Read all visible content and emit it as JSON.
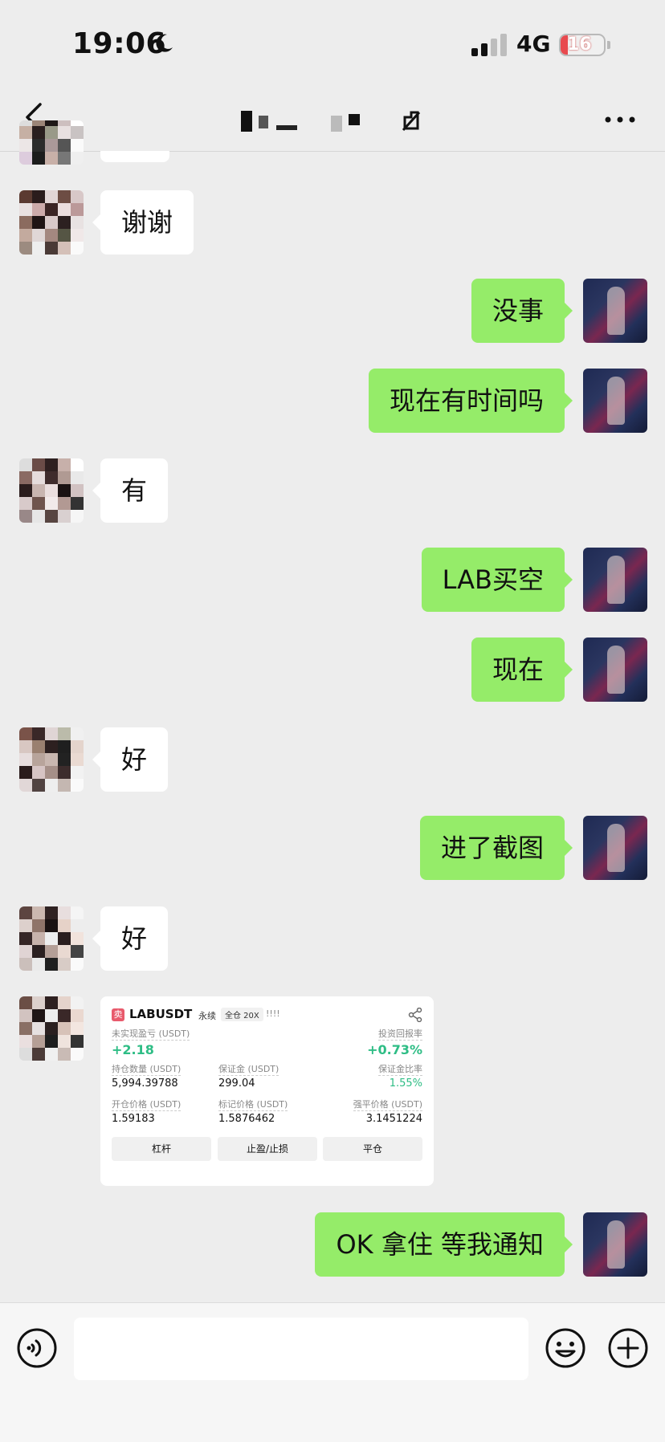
{
  "status": {
    "time": "19:06",
    "network": "4G",
    "battery": "16"
  },
  "nav": {
    "title": ""
  },
  "messages": [
    {
      "side": "left",
      "text": "谢谢"
    },
    {
      "side": "right",
      "text": "没事"
    },
    {
      "side": "right",
      "text": "现在有时间吗"
    },
    {
      "side": "left",
      "text": "有"
    },
    {
      "side": "right",
      "text": "LAB买空"
    },
    {
      "side": "right",
      "text": "现在"
    },
    {
      "side": "left",
      "text": "好"
    },
    {
      "side": "right",
      "text": "进了截图"
    },
    {
      "side": "left",
      "text": "好"
    },
    {
      "side": "right",
      "text": "OK 拿住 等我通知"
    }
  ],
  "card": {
    "badge": "卖",
    "symbol": "LABUSDT",
    "perpetual": "永续",
    "margin_mode": "全仓 20X",
    "bangs": "!!!!",
    "unrealized_label": "未实现盈亏 (USDT)",
    "unrealized_value": "+2.18",
    "roi_label": "投资回报率",
    "roi_value": "+0.73%",
    "size_label": "持仓数量 (USDT)",
    "size_value": "5,994.39788",
    "margin_label": "保证金 (USDT)",
    "margin_value": "299.04",
    "margin_ratio_label": "保证金比率",
    "margin_ratio_value": "1.55%",
    "entry_label": "开仓价格 (USDT)",
    "entry_value": "1.59183",
    "mark_label": "标记价格 (USDT)",
    "mark_value": "1.5876462",
    "liq_label": "强平价格 (USDT)",
    "liq_value": "3.1451224",
    "btn_leverage": "杠杆",
    "btn_tpsl": "止盈/止损",
    "btn_close": "平仓"
  },
  "input": {
    "value": ""
  },
  "colors": {
    "bubble_self": "#95ec69",
    "bubble_other": "#ffffff",
    "background": "#ededed",
    "profit": "#2ebd85"
  }
}
